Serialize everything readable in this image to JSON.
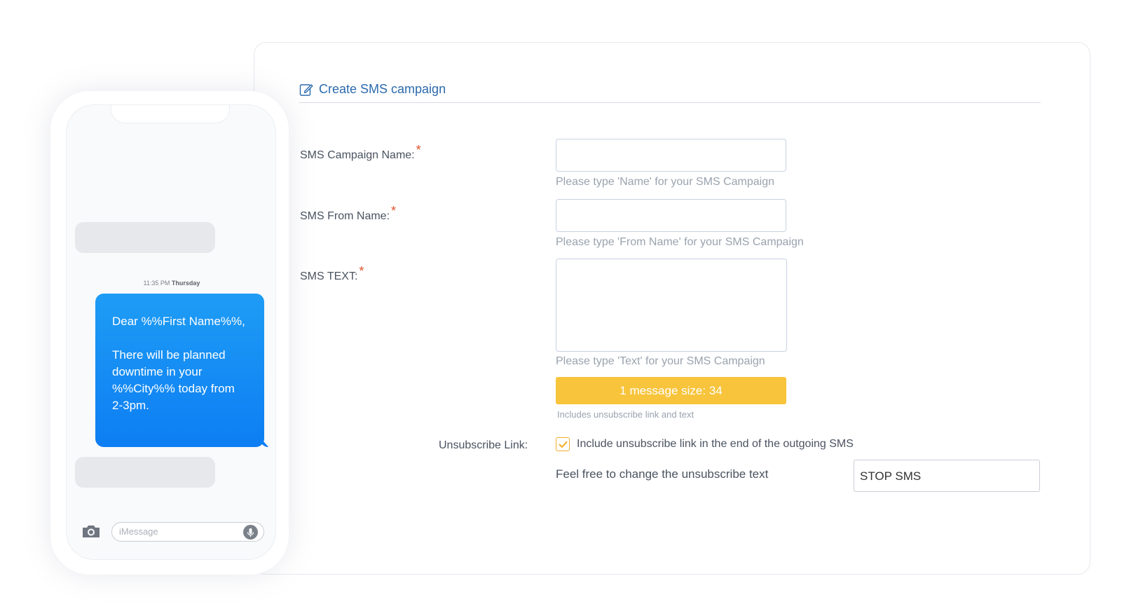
{
  "form": {
    "title": "Create SMS campaign",
    "campaign_name": {
      "label": "SMS Campaign Name:",
      "required_mark": "*",
      "value": "",
      "hint": "Please type 'Name' for your SMS Campaign"
    },
    "from_name": {
      "label": "SMS From Name:",
      "required_mark": "*",
      "value": "",
      "hint": "Please type 'From Name' for your SMS Campaign"
    },
    "sms_text": {
      "label": "SMS TEXT:",
      "required_mark": "*",
      "value": "",
      "hint": "Please type 'Text' for your SMS Campaign"
    },
    "message_size": {
      "label": "1 message size: 34",
      "note": "Includes unsubscribe link and text"
    },
    "unsubscribe": {
      "label": "Unsubscribe Link:",
      "checked": true,
      "checkbox_label": "Include unsubscribe link in the end of the outgoing SMS",
      "change_label": "Feel free to change the unsubscribe text",
      "text_value": "STOP SMS"
    }
  },
  "phone": {
    "timestamp_time": "11:35 PM",
    "timestamp_day": "Thursday",
    "message_lines": [
      "Dear %%First Name%%,",
      "",
      "There will be planned",
      "downtime in your",
      "%%City%% today from",
      "2-3pm."
    ],
    "input_placeholder": "iMessage"
  },
  "colors": {
    "accent_blue": "#2c6aad",
    "required_red": "#e2522c",
    "size_bar_yellow": "#f7c43c",
    "bubble_blue": "#0d7ef3"
  },
  "icons": [
    "edit-icon",
    "checkmark-icon",
    "camera-icon",
    "microphone-icon"
  ]
}
